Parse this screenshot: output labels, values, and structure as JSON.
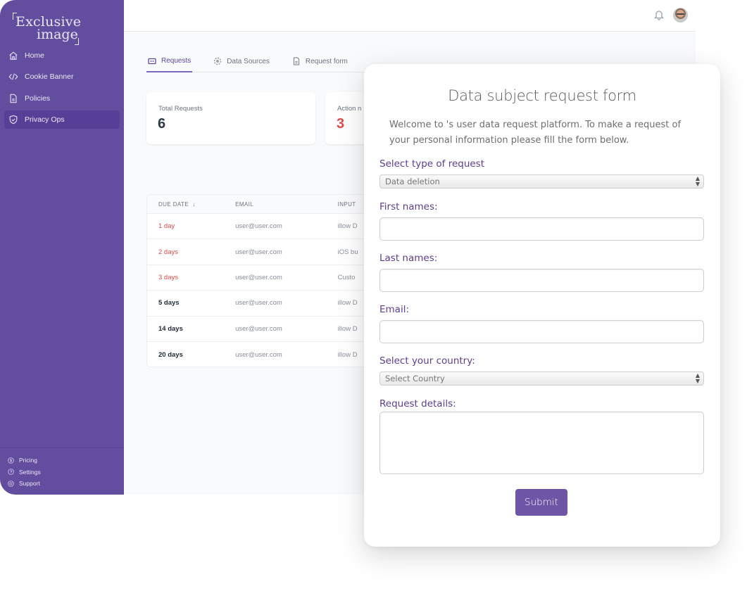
{
  "brand": {
    "line1": "Exclusive",
    "line2": "image"
  },
  "sidebar": {
    "items": [
      {
        "label": "Home",
        "icon": "home-icon"
      },
      {
        "label": "Cookie Banner",
        "icon": "code-icon"
      },
      {
        "label": "Policies",
        "icon": "document-icon"
      },
      {
        "label": "Privacy Ops",
        "icon": "shield-check-icon",
        "active": true
      }
    ],
    "bottom": [
      {
        "label": "Pricing",
        "icon": "dollar-icon"
      },
      {
        "label": "Settings",
        "icon": "settings-icon"
      },
      {
        "label": "Support",
        "icon": "support-icon"
      }
    ]
  },
  "topbar": {
    "notifications_icon": "bell-icon",
    "avatar": "user-avatar"
  },
  "tabs": [
    {
      "label": "Requests",
      "icon": "ticket-icon",
      "active": true
    },
    {
      "label": "Data Sources",
      "icon": "data-sources-icon"
    },
    {
      "label": "Request form",
      "icon": "document-icon"
    }
  ],
  "stats": {
    "total": {
      "label": "Total Requests",
      "value": "6"
    },
    "action": {
      "label": "Action n",
      "value": "3",
      "color": "#e04b4b"
    }
  },
  "table": {
    "headers": {
      "due": "DUE DATE",
      "sort_icon": "↓",
      "email": "EMAIL",
      "input": "INPUT"
    },
    "rows": [
      {
        "due": "1 day",
        "email": "user@user.com",
        "input": "illow D",
        "urgent": true
      },
      {
        "due": "2 days",
        "email": "user@user.com",
        "input": "iOS bu",
        "urgent": true
      },
      {
        "due": "3 days",
        "email": "user@user.com",
        "input": "Custo",
        "urgent": true
      },
      {
        "due": "5 days",
        "email": "user@user.com",
        "input": "illow D",
        "urgent": false
      },
      {
        "due": "14 days",
        "email": "user@user.com",
        "input": "illow D",
        "urgent": false
      },
      {
        "due": "20 days",
        "email": "user@user.com",
        "input": "illow D",
        "urgent": false
      }
    ]
  },
  "form": {
    "title": "Data subject request form",
    "intro": "Welcome to 's user data request platform. To make a request of your personal information please fill the form below.",
    "request_type_label": "Select type of request",
    "request_type_value": "Data deletion",
    "first_names_label": "First names:",
    "first_names_value": "",
    "last_names_label": "Last names:",
    "last_names_value": "",
    "email_label": "Email:",
    "email_value": "",
    "country_label": "Select your country:",
    "country_value": "Select Country",
    "details_label": "Request details:",
    "details_value": "",
    "submit_label": "Submit"
  },
  "colors": {
    "brand": "#634d9f",
    "accent": "#6e55a6",
    "danger": "#e04b4b"
  }
}
